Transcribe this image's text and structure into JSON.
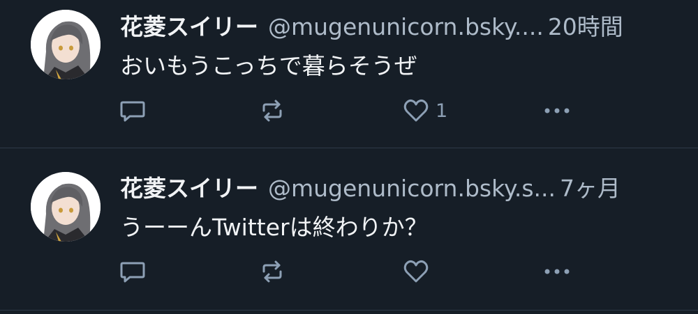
{
  "posts": [
    {
      "author_name": "花菱スイリー",
      "handle": "@mugenunicorn.bsky....",
      "time": "20時間",
      "text": "おいもうこっちで暮らそうぜ",
      "like_count": "1"
    },
    {
      "author_name": "花菱スイリー",
      "handle": "@mugenunicorn.bsky.s...",
      "time": "7ヶ月",
      "text": "うーーんTwitterは終わりか？",
      "like_count": ""
    }
  ],
  "icons": {
    "reply": "speech-bubble-icon",
    "repost": "repost-arrows-icon",
    "like": "heart-icon",
    "more": "ellipsis-icon"
  },
  "colors": {
    "background": "#161e27",
    "text": "#f1f3f5",
    "secondary_text": "#aebbc9",
    "icon": "#8da0b5",
    "divider": "#2e3a48"
  }
}
